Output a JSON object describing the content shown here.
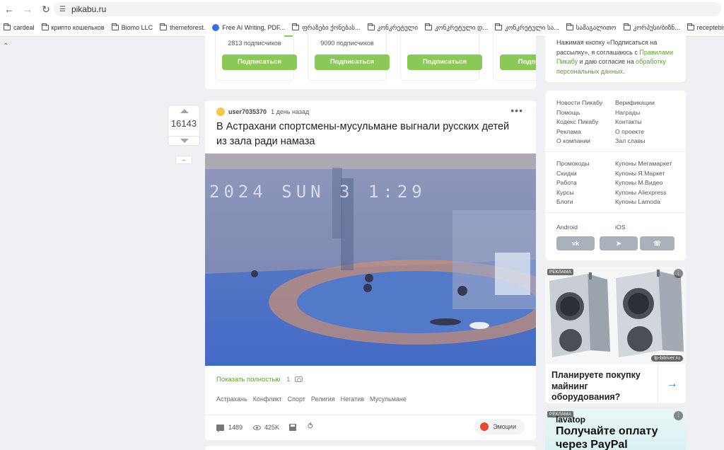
{
  "browser": {
    "url": "pikabu.ru",
    "bookmarks": [
      {
        "label": "cardeal",
        "icon": "folder-icon"
      },
      {
        "label": "крипто кошельков",
        "icon": "folder-icon"
      },
      {
        "label": "Biomo LLC",
        "icon": "folder-icon"
      },
      {
        "label": "themeforest.",
        "icon": "folder-icon"
      },
      {
        "label": "Free AI Writing, PDF...",
        "icon": "globe-icon"
      },
      {
        "label": "ფრაზები ქონებას...",
        "icon": "folder-icon"
      },
      {
        "label": "კონკრეტული",
        "icon": "folder-icon"
      },
      {
        "label": "კონკრეტული დ...",
        "icon": "folder-icon"
      },
      {
        "label": "კონკრეტული სა...",
        "icon": "folder-icon"
      },
      {
        "label": "სამაგალითო",
        "icon": "folder-icon"
      },
      {
        "label": "კორპუსი/ბიზნ...",
        "icon": "folder-icon"
      },
      {
        "label": "receptebis sati",
        "icon": "folder-icon"
      }
    ]
  },
  "subscriptions": {
    "items": [
      {
        "count": "2813 подписчиков",
        "button": "Подписаться"
      },
      {
        "count": "9090 подписчиков",
        "button": "Подписаться"
      },
      {
        "count": "",
        "button": "Подписаться"
      },
      {
        "count": "",
        "button": "Подпи"
      }
    ]
  },
  "post": {
    "rating": "16143",
    "minus": "–",
    "author": "user7035370",
    "time": "1 день назад",
    "more": "•••",
    "title": "В Астрахани спортсмены-мусульмане выгнали русских детей из зала ради намаза",
    "video_overlay": "2024 SUN 3 1:29",
    "show_full": "Показать полностью",
    "photo_count": "1",
    "tags": [
      "Астрахань",
      "Конфликт",
      "Спорт",
      "Религия",
      "Негатив",
      "Мусульмане"
    ],
    "comments": "1489",
    "views": "425K",
    "emotions": "Эмоции"
  },
  "sidebar": {
    "consent": {
      "prefix": "Нажимая кнопку «Подписаться на рассылку», я соглашаюсь с ",
      "rules_link": "Правилами Пикабу",
      "middle": " и даю согласие на ",
      "data_link": "обработку персональных данных",
      "suffix": "."
    },
    "links_group1": {
      "left": [
        "Новости Пикабу",
        "Помощь",
        "Кодекс Пикабу",
        "Реклама",
        "О компании"
      ],
      "right": [
        "Верификации",
        "Награды",
        "Контакты",
        "О проекте",
        "Зал славы"
      ]
    },
    "links_group2": {
      "left": [
        "Промокоды",
        "Скидки",
        "Работа",
        "Курсы",
        "Блоги"
      ],
      "right": [
        "Купоны Мегамаркет",
        "Купоны Я.Маркет",
        "Купоны М.Видео",
        "Купоны Aliexpress",
        "Купоны Lamoda"
      ]
    },
    "apps": {
      "android": "Android",
      "ios": "iOS"
    },
    "social": [
      "vk",
      "telegram",
      "viber"
    ],
    "ad1": {
      "label": "РЕКЛАМА",
      "domain": "lp-bitriver.ru",
      "text": "Планируете покупку майнинг оборудования?",
      "arrow": "→"
    },
    "ad2": {
      "label": "РЕКЛАМА",
      "brand": "lavatop",
      "text": "Получайте оплату через PayPal"
    }
  },
  "colors": {
    "accent_green": "#8ac858",
    "link_green": "#5c9e33",
    "page_bg": "#eef0f3"
  }
}
